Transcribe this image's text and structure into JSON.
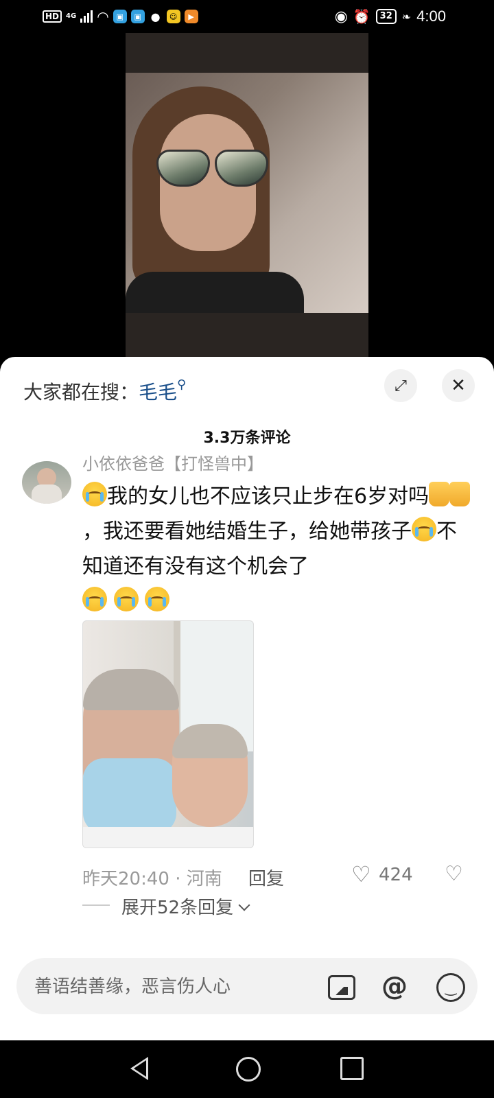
{
  "status_bar": {
    "hd": "HD",
    "network": "4G",
    "battery": "32",
    "time": "4:00",
    "icons": [
      "signal-icon",
      "wifi-icon",
      "app-icon",
      "app-icon",
      "wechat-icon",
      "app-icon",
      "app-icon",
      "eye-icon",
      "alarm-icon",
      "leaf-icon"
    ]
  },
  "sheet": {
    "search_prefix": "大家都在搜：",
    "search_keyword": "毛毛",
    "comments_count": "3.3万条评论"
  },
  "comment": {
    "username": "小依依爸爸【打怪兽中】",
    "text_part1": "我的女儿也不应该只止步在6岁对吗",
    "text_part2": "，我还要看她结婚生子，给她带孩子",
    "text_part3": "不知道还有没有这个机会了",
    "meta": "昨天20:40 · 河南",
    "reply_label": "回复",
    "likes": "424",
    "expand_label": "展开52条回复"
  },
  "input": {
    "placeholder": "善语结善缘，恶言伤人心"
  },
  "colors": {
    "keyword": "#1a4f8a",
    "sheet_bg": "#ffffff",
    "muted": "#999999"
  }
}
